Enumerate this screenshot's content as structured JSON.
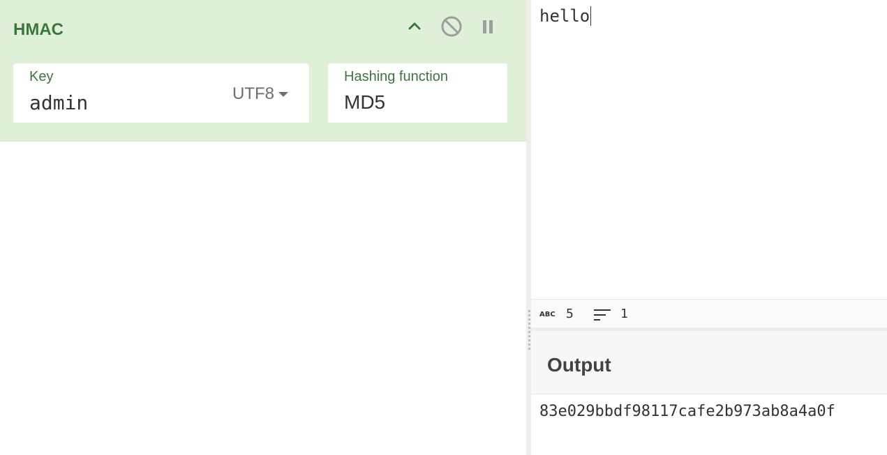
{
  "recipe": {
    "operation": {
      "title": "HMAC",
      "controls": [
        {
          "name": "chevron-up-icon",
          "label": "collapse"
        },
        {
          "name": "disable-icon",
          "label": "disable"
        },
        {
          "name": "pause-icon",
          "label": "breakpoint"
        }
      ]
    },
    "key_field": {
      "label": "Key",
      "value": "admin",
      "encoding": "UTF8"
    },
    "hash_field": {
      "label": "Hashing function",
      "value": "MD5"
    }
  },
  "input": {
    "text": "hello"
  },
  "status": {
    "length_icon": "abc-icon",
    "length_badge": "ABC",
    "length": "5",
    "lines_icon": "lines-icon",
    "lines": "1"
  },
  "output": {
    "title": "Output",
    "value": "83e029bbdf98117cafe2b973ab8a4a0f"
  },
  "colors": {
    "recipe_bg": "#dff0d8",
    "accent": "#3c763d"
  }
}
